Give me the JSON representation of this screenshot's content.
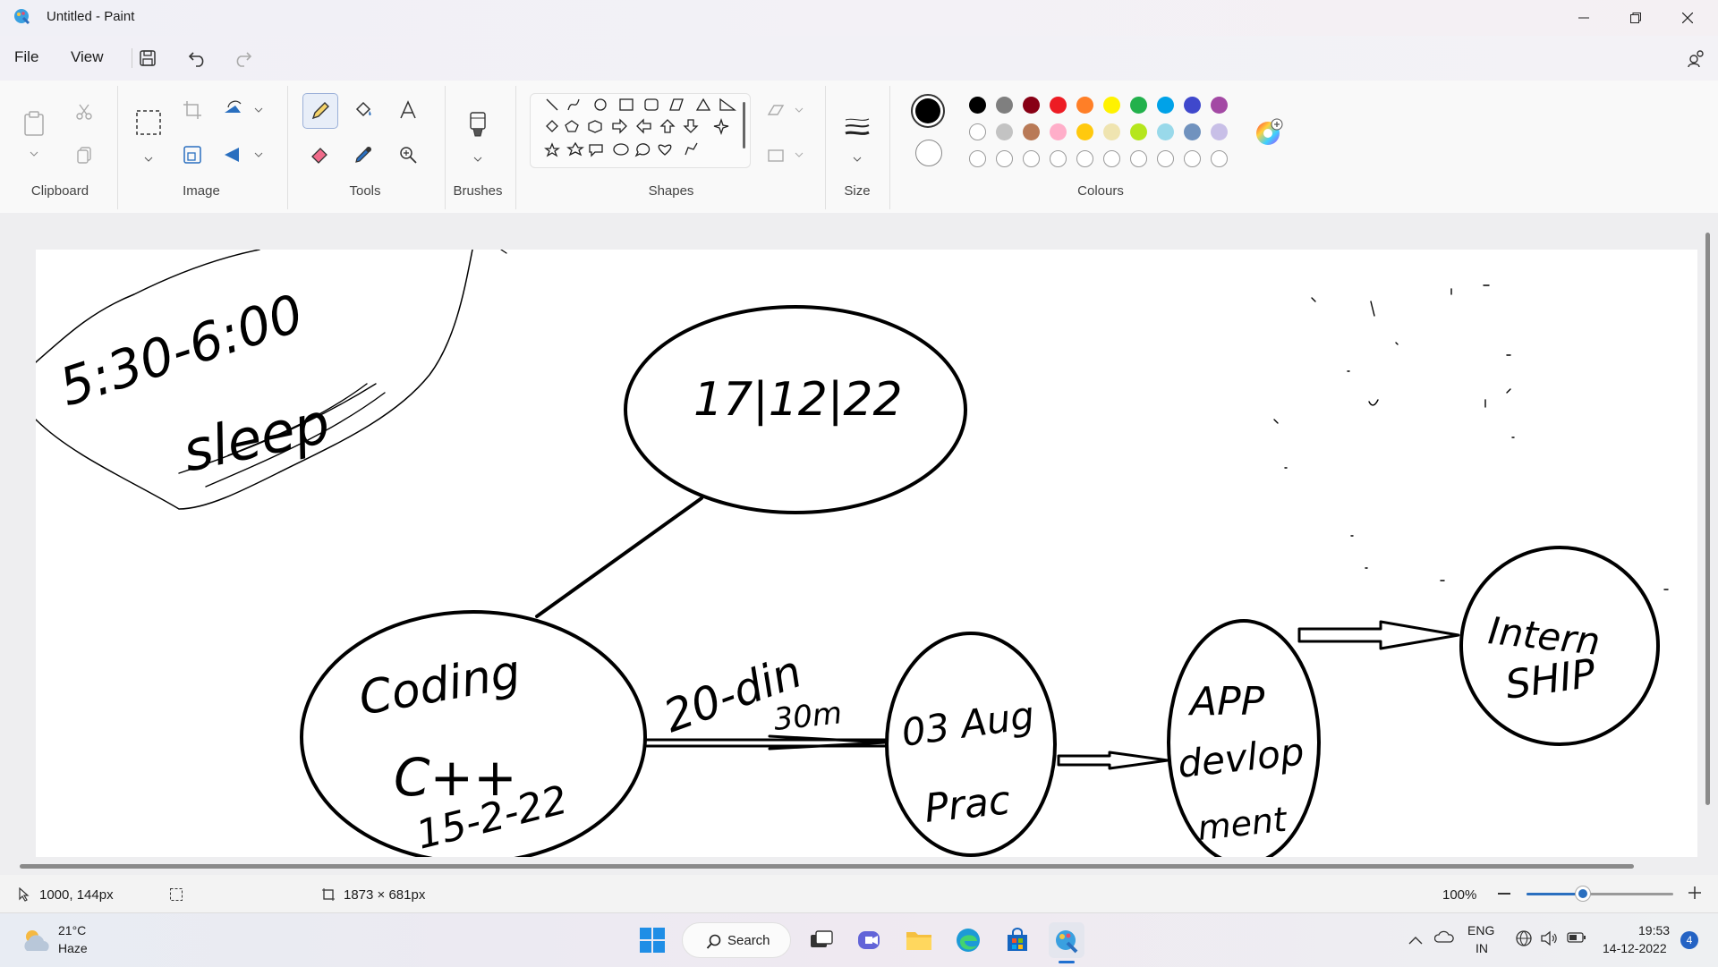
{
  "window": {
    "title": "Untitled - Paint"
  },
  "menu": {
    "file": "File",
    "view": "View"
  },
  "ribbon": {
    "groups": {
      "clipboard": "Clipboard",
      "image": "Image",
      "tools": "Tools",
      "brushes": "Brushes",
      "shapes": "Shapes",
      "size": "Size",
      "colours": "Colours"
    }
  },
  "colours": {
    "primary": "#000000",
    "secondary": "#ffffff",
    "row1": [
      "#000000",
      "#7f7f7f",
      "#880015",
      "#ed1c24",
      "#ff7f27",
      "#fff200",
      "#22b14c",
      "#00a2e8",
      "#3f48cc",
      "#a349a4"
    ],
    "row2": [
      "#ffffff",
      "#c3c3c3",
      "#b97a57",
      "#ffaec9",
      "#ffc90e",
      "#efe4b0",
      "#b5e61d",
      "#99d9ea",
      "#7092be",
      "#c8bfe7"
    ]
  },
  "status": {
    "cursor_pos": "1000, 144px",
    "canvas_size": "1873 × 681px",
    "zoom": "100%"
  },
  "taskbar": {
    "weather_temp": "21°C",
    "weather_desc": "Haze",
    "search": "Search",
    "lang_top": "ENG",
    "lang_bottom": "IN",
    "time": "19:53",
    "date": "14-12-2022",
    "notif_count": "4"
  },
  "drawing": {
    "bubble_top": "17|12|22",
    "left_blob": [
      "5:30-6:00",
      "sleep"
    ],
    "bubble_coding": [
      "Coding",
      "C++",
      "15-2-22"
    ],
    "arrow_label": [
      "20-din",
      "30m"
    ],
    "bubble_practice": [
      "03 Aug",
      "Prac"
    ],
    "bubble_app": [
      "APP",
      "devlop",
      "ment"
    ],
    "bubble_intern": [
      "Intern",
      "SHIP"
    ]
  }
}
